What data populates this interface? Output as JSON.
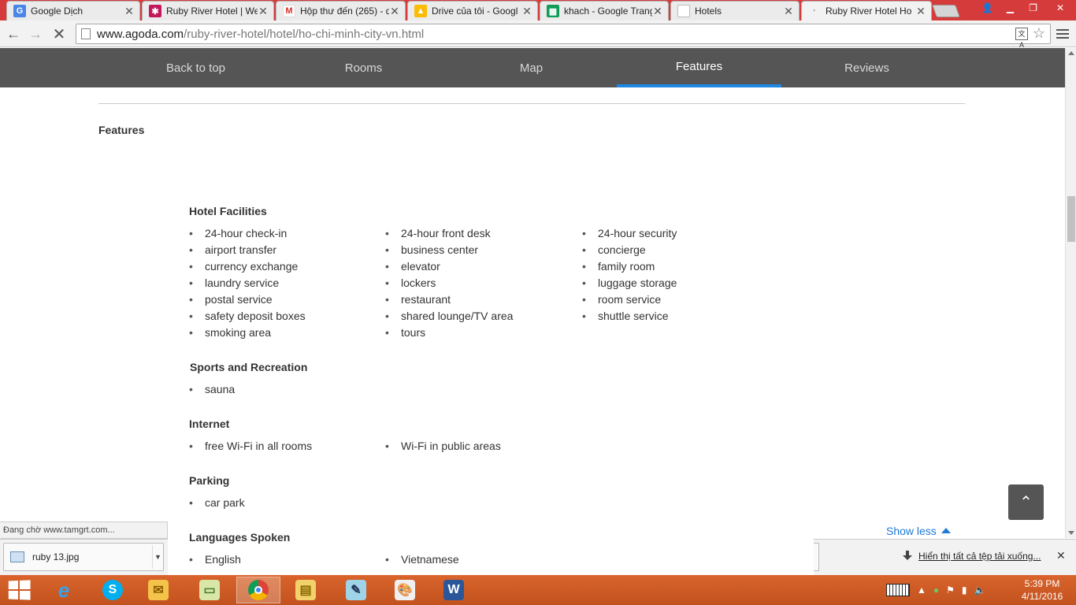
{
  "browser": {
    "tabs": [
      {
        "title": "Google Dịch",
        "icon": "google-translate-icon",
        "color": "#4a86e8"
      },
      {
        "title": "Ruby River Hotel | We",
        "icon": "agoda-icon",
        "color": "#c2185b"
      },
      {
        "title": "Hộp thư đến (265) - d",
        "icon": "gmail-icon",
        "color": "#d93025"
      },
      {
        "title": "Drive của tôi - Googl",
        "icon": "google-drive-icon",
        "color": "#0f9d58"
      },
      {
        "title": "khach - Google Trang",
        "icon": "google-sheets-icon",
        "color": "#0f9d58"
      },
      {
        "title": "Hotels",
        "icon": "page-icon",
        "color": "#bbbbbb"
      },
      {
        "title": "Ruby River Hotel Ho",
        "icon": "loading-icon",
        "color": "#888888"
      }
    ],
    "url_host": "www.agoda.com",
    "url_path": "/ruby-river-hotel/hotel/ho-chi-minh-city-vn.html",
    "status_text": "Đang chờ www.tamgrt.com..."
  },
  "page_nav": {
    "items": [
      "Back to top",
      "Rooms",
      "Map",
      "Features",
      "Reviews"
    ],
    "active": "Features",
    "accent": "#1e88e5"
  },
  "features": {
    "section_title": "Features",
    "groups": [
      {
        "title": "Hotel Facilities",
        "items": [
          "24-hour check-in",
          "24-hour front desk",
          "24-hour security",
          "airport transfer",
          "business center",
          "concierge",
          "currency exchange",
          "elevator",
          "family room",
          "laundry service",
          "lockers",
          "luggage storage",
          "postal service",
          "restaurant",
          "room service",
          "safety deposit boxes",
          "shared lounge/TV area",
          "shuttle service",
          "smoking area",
          "tours"
        ]
      },
      {
        "title": "Sports and Recreation",
        "items": [
          "sauna"
        ]
      },
      {
        "title": "Internet",
        "items": [
          "free Wi-Fi in all rooms",
          "Wi-Fi in public areas"
        ]
      },
      {
        "title": "Parking",
        "items": [
          "car park"
        ]
      },
      {
        "title": "Languages Spoken",
        "items": [
          "English",
          "Vietnamese"
        ]
      }
    ],
    "show_less": "Show less"
  },
  "downloads": {
    "file": "ruby 13.jpg",
    "show_all": "Hiển thị tất cả tệp tải xuống..."
  },
  "taskbar": {
    "apps": [
      "internet-explorer",
      "skype",
      "outlook",
      "photos",
      "chrome",
      "file-explorer",
      "notepad",
      "paint",
      "word"
    ],
    "time": "5:39 PM",
    "date": "4/11/2016"
  }
}
